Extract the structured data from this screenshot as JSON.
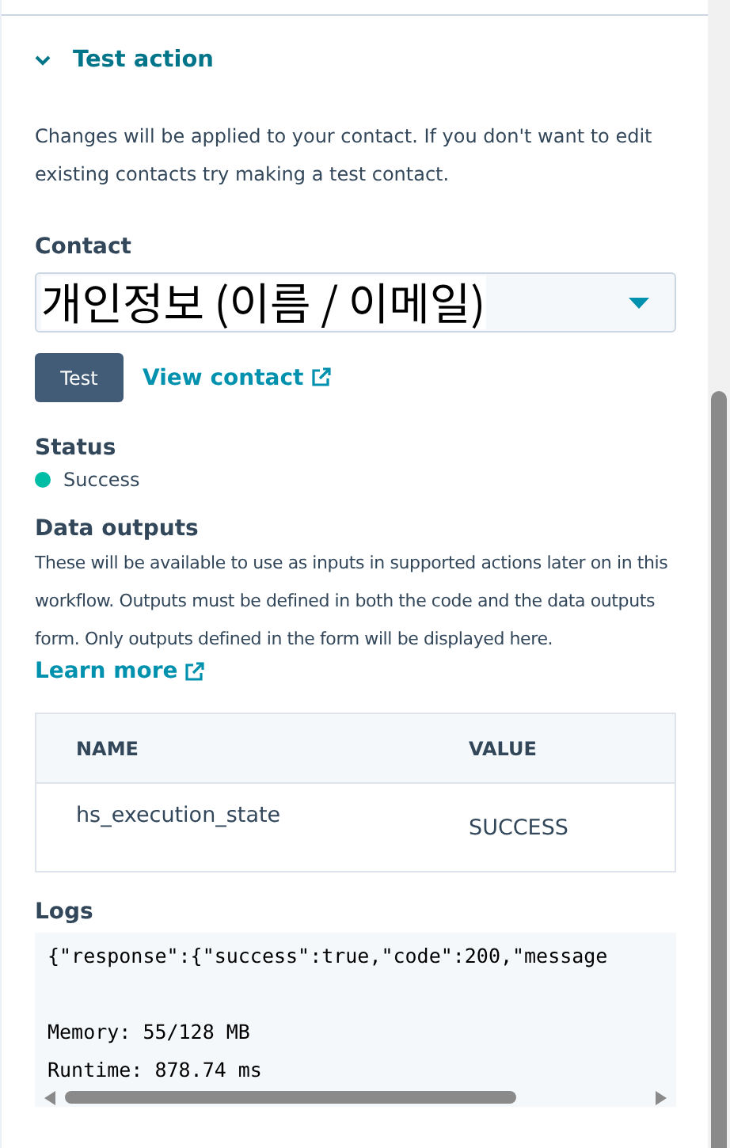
{
  "section": {
    "title": "Test action",
    "expanded": true
  },
  "intro": "Changes will be applied to your contact. If you don't want to edit existing contacts try making a test contact.",
  "contact": {
    "label": "Contact",
    "value": "개인정보 (이름 / 이메일)"
  },
  "test_button": "Test",
  "view_contact": "View contact",
  "status": {
    "heading": "Status",
    "label": "Success",
    "color": "#00bda5"
  },
  "data_outputs": {
    "heading": "Data outputs",
    "description": "These will be available to use as inputs in supported actions later on in this workflow. Outputs must be defined in both the code and the data outputs form. Only outputs defined in the form will be displayed here.",
    "learn_more": "Learn more"
  },
  "table": {
    "columns": [
      "NAME",
      "VALUE"
    ],
    "rows": [
      [
        "hs_execution_state",
        "SUCCESS"
      ]
    ]
  },
  "logs": {
    "heading": "Logs",
    "lines": [
      "{\"response\":{\"success\":true,\"code\":200,\"message",
      "Memory: 55/128 MB",
      "Runtime: 878.74 ms"
    ]
  }
}
